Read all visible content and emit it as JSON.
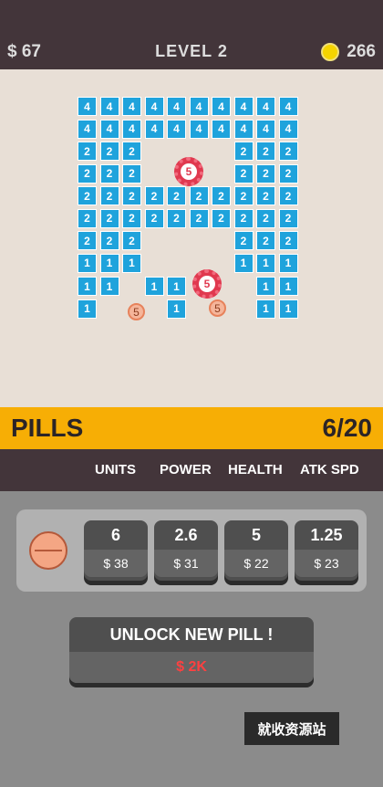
{
  "topbar": {
    "money": "$ 67",
    "level": "LEVEL 2",
    "coins": "266"
  },
  "board": {
    "rows": [
      [
        "4",
        "4",
        "4",
        "4",
        "4",
        "4",
        "4",
        "4",
        "4",
        "4"
      ],
      [
        "4",
        "4",
        "4",
        "4",
        "4",
        "4",
        "4",
        "4",
        "4",
        "4"
      ],
      [
        "2",
        "2",
        "2",
        null,
        null,
        null,
        null,
        "2",
        "2",
        "2"
      ],
      [
        "2",
        "2",
        "2",
        null,
        null,
        null,
        null,
        "2",
        "2",
        "2"
      ],
      [
        "2",
        "2",
        "2",
        "2",
        "2",
        "2",
        "2",
        "2",
        "2",
        "2"
      ],
      [
        "2",
        "2",
        "2",
        "2",
        "2",
        "2",
        "2",
        "2",
        "2",
        "2"
      ],
      [
        "2",
        "2",
        "2",
        null,
        null,
        null,
        null,
        "2",
        "2",
        "2"
      ],
      [
        "1",
        "1",
        "1",
        null,
        null,
        null,
        null,
        "1",
        "1",
        "1"
      ],
      [
        "1",
        "1",
        null,
        "1",
        "1",
        null,
        null,
        null,
        "1",
        "1"
      ],
      [
        "1",
        null,
        null,
        null,
        "1",
        null,
        null,
        null,
        "1",
        "1"
      ]
    ],
    "viruses": [
      "5",
      "5"
    ],
    "balls": [
      "5",
      "5"
    ]
  },
  "pills": {
    "title": "PILLS",
    "count": "6/20"
  },
  "stats": {
    "units": "UNITS",
    "power": "POWER",
    "health": "HEALTH",
    "atk_spd": "ATK SPD"
  },
  "upgrades": [
    {
      "value": "6",
      "cost": "$ 38"
    },
    {
      "value": "2.6",
      "cost": "$ 31"
    },
    {
      "value": "5",
      "cost": "$ 22"
    },
    {
      "value": "1.25",
      "cost": "$ 23"
    }
  ],
  "unlock": {
    "label": "UNLOCK NEW PILL !",
    "price": "$ 2K"
  },
  "watermark": "就收资源站",
  "colors": {
    "brick": "#1fa3dc",
    "virus": "#e0394f",
    "accent": "#f7ae05",
    "dark": "#43353a",
    "coin": "#f5d400"
  }
}
